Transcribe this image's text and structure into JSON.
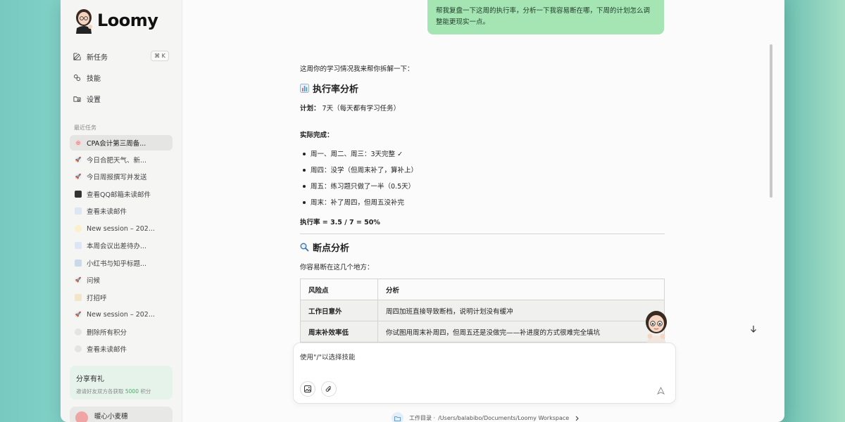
{
  "app": {
    "name": "Loomy"
  },
  "sidebar": {
    "nav": [
      {
        "label": "新任务",
        "shortcut": "⌘ K",
        "icon": "edit-icon"
      },
      {
        "label": "技能",
        "icon": "skills-icon"
      },
      {
        "label": "设置",
        "icon": "settings-folder-icon"
      }
    ],
    "recent_title": "最近任务",
    "tasks": [
      {
        "label": "CPA会计第三周备...",
        "active": true,
        "icon": "target-icon"
      },
      {
        "label": "今日合肥天气、新...",
        "icon": "rocket-icon"
      },
      {
        "label": "今日周报撰写并发送",
        "icon": "rocket-icon"
      },
      {
        "label": "查看QQ邮箱未读邮件",
        "icon": "computer-icon"
      },
      {
        "label": "查看未读邮件",
        "icon": "chart-icon"
      },
      {
        "label": "New session – 202...",
        "icon": "bulb-icon"
      },
      {
        "label": "本周会议出差待办...",
        "icon": "chart-icon"
      },
      {
        "label": "小红书与知乎标题...",
        "icon": "book-icon"
      },
      {
        "label": "问候",
        "icon": "rocket-icon"
      },
      {
        "label": "打招呼",
        "icon": "memo-icon"
      },
      {
        "label": "New session – 202...",
        "icon": "rocket-icon"
      },
      {
        "label": "删除所有积分",
        "icon": "magnifier-icon"
      },
      {
        "label": "查看未读邮件",
        "icon": "magnifier-icon"
      }
    ],
    "share": {
      "title": "分享有礼",
      "sub_prefix": "邀请好友双方各获取",
      "points": "5000",
      "sub_suffix": "积分"
    },
    "user": {
      "name": "暖心小麦穗"
    }
  },
  "chat": {
    "user_message": "帮我复盘一下这周的执行率，分析一下我容易断在哪，下周的计划怎么调整能更现实一点。",
    "intro": "这周你的学习情况我来帮你拆解一下：",
    "section1_title": "执行率分析",
    "plan_label": "计划：",
    "plan_value": "7天（每天都有学习任务）",
    "actual_label": "实际完成：",
    "actual_items": [
      "周一、周二、周三：3天完整 ✓",
      "周四：没学（但周末补了，算补上）",
      "周五：练习题只做了一半（0.5天）",
      "周末：补了周四，但周五没补完"
    ],
    "rate": "执行率 = 3.5 / 7 = 50%",
    "section2_title": "断点分析",
    "section2_intro": "你容易断在这几个地方：",
    "table": {
      "headers": [
        "风险点",
        "分析"
      ],
      "rows": [
        [
          "工作日意外",
          "周四加班直接导致断档，说明计划没有缓冲"
        ],
        [
          "周末补效率低",
          "你试图用周末补周四，但周五还是没做完——补进度的方式很难完全填坑"
        ]
      ]
    }
  },
  "composer": {
    "placeholder": "使用\"/\"以选择技能"
  },
  "footer": {
    "label": "工作目录 ·",
    "path": "/Users/balabibo/Documents/Loomy Workspace"
  }
}
